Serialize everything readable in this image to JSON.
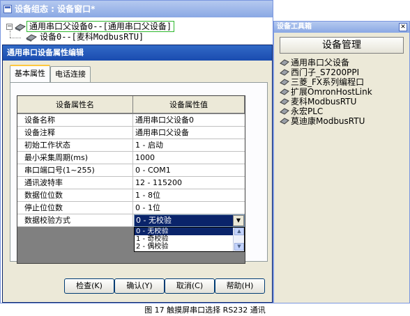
{
  "main_window": {
    "title": "设备组态 : 设备窗口*",
    "tree": {
      "root_label": "通用串口父设备0--[通用串口父设备]",
      "child_label": "设备0--[麦科ModbusRTU]",
      "expander": "⊟"
    }
  },
  "dialog": {
    "title": "通用串口设备属性编辑",
    "tabs": [
      "基本属性",
      "电话连接"
    ],
    "grid": {
      "headers": [
        "设备属性名",
        "设备属性值"
      ],
      "rows": [
        {
          "name": "设备名称",
          "value": "通用串口父设备0"
        },
        {
          "name": "设备注释",
          "value": "通用串口父设备"
        },
        {
          "name": "初始工作状态",
          "value": "1 - 启动"
        },
        {
          "name": "最小采集周期(ms)",
          "value": "1000"
        },
        {
          "name": "串口端口号(1~255)",
          "value": "0 - COM1"
        },
        {
          "name": "通讯波特率",
          "value": "12 - 115200"
        },
        {
          "name": "数据位位数",
          "value": "1 - 8位"
        },
        {
          "name": "停止位位数",
          "value": "0 - 1位"
        },
        {
          "name": "数据校验方式",
          "value": ""
        }
      ]
    },
    "combo": {
      "selected": "0 - 无校验",
      "options": [
        "0 - 无校验",
        "1 - 奇校验",
        "2 - 偶校验"
      ]
    },
    "buttons": {
      "check": "检查(K)",
      "ok": "确认(Y)",
      "cancel": "取消(C)",
      "help": "帮助(H)"
    }
  },
  "toolbox": {
    "title": "设备工具箱",
    "close_glyph": "✕",
    "manage_button": "设备管理",
    "items": [
      "通用串口父设备",
      "西门子_S7200PPI",
      "三菱_FX系列编程口",
      "扩展OmronHostLink",
      "麦科ModbusRTU",
      "永宏PLC",
      "莫迪康ModbusRTU"
    ]
  },
  "caption": "图 17 触摸屏串口选择 RS232 通讯",
  "colors": {
    "titlebar": "#1a4cb0",
    "selection": "#0a246a",
    "dialog_bg": "#ece9d8",
    "tree_highlight_border": "#2db82d"
  },
  "icons": {
    "tree": "device-tree-icon",
    "toolbox_item": "device-driver-icon",
    "close": "close-icon",
    "dropdown": "chevron-down-icon"
  }
}
